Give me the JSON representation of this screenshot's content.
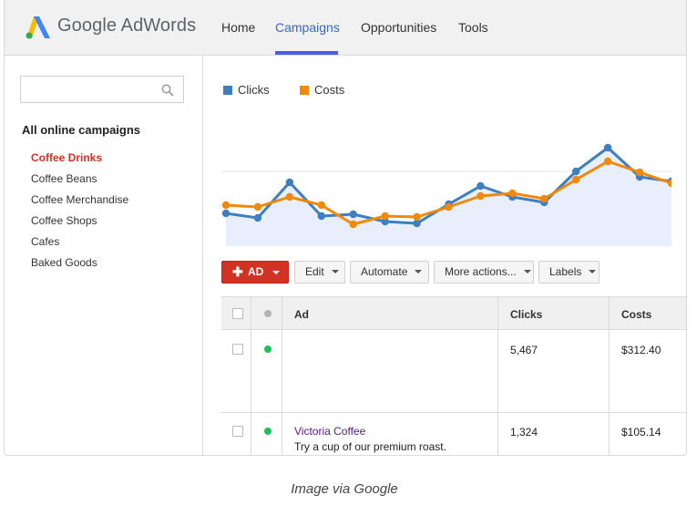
{
  "header": {
    "brand": "Google AdWords",
    "nav": [
      {
        "label": "Home",
        "active": false
      },
      {
        "label": "Campaigns",
        "active": true
      },
      {
        "label": "Opportunities",
        "active": false
      },
      {
        "label": "Tools",
        "active": false
      }
    ]
  },
  "sidebar": {
    "search_value": "",
    "heading": "All online campaigns",
    "items": [
      {
        "label": "Coffee Drinks",
        "active": true
      },
      {
        "label": "Coffee Beans",
        "active": false
      },
      {
        "label": "Coffee Merchandise",
        "active": false
      },
      {
        "label": "Coffee Shops",
        "active": false
      },
      {
        "label": "Cafes",
        "active": false
      },
      {
        "label": "Baked Goods",
        "active": false
      }
    ]
  },
  "legend": {
    "clicks": "Clicks",
    "costs": "Costs"
  },
  "colors": {
    "clicks": "#3d7fc1",
    "costs": "#f0890c",
    "ad_button": "#d23221",
    "active_nav": "#3367d6",
    "active_campaign": "#d93025",
    "status_enabled": "#1fbf5c"
  },
  "chart_data": {
    "type": "line",
    "x": [
      1,
      2,
      3,
      4,
      5,
      6,
      7,
      8,
      9,
      10,
      11,
      12,
      13,
      14,
      15
    ],
    "ylim": [
      0,
      120
    ],
    "series": [
      {
        "name": "Clicks",
        "values": [
          36,
          31,
          70,
          33,
          35,
          27,
          25,
          46,
          66,
          54,
          48,
          82,
          108,
          76,
          71
        ]
      },
      {
        "name": "Costs",
        "values": [
          45,
          43,
          54,
          45,
          24,
          33,
          32,
          43,
          55,
          58,
          52,
          73,
          93,
          81,
          69
        ]
      }
    ]
  },
  "toolbar": {
    "ad_label": "AD",
    "edit_label": "Edit",
    "automate_label": "Automate",
    "more_actions_label": "More actions...",
    "labels_label": "Labels"
  },
  "table": {
    "headers": {
      "ad": "Ad",
      "clicks": "Clicks",
      "costs": "Costs"
    },
    "rows": [
      {
        "ad_title": "",
        "ad_text": "",
        "clicks": "5,467",
        "costs": "$312.40"
      },
      {
        "ad_title": "Victoria Coffee",
        "ad_text": "Try a cup of our premium roast.",
        "clicks": "1,324",
        "costs": "$105.14"
      }
    ]
  },
  "caption": "Image via Google"
}
